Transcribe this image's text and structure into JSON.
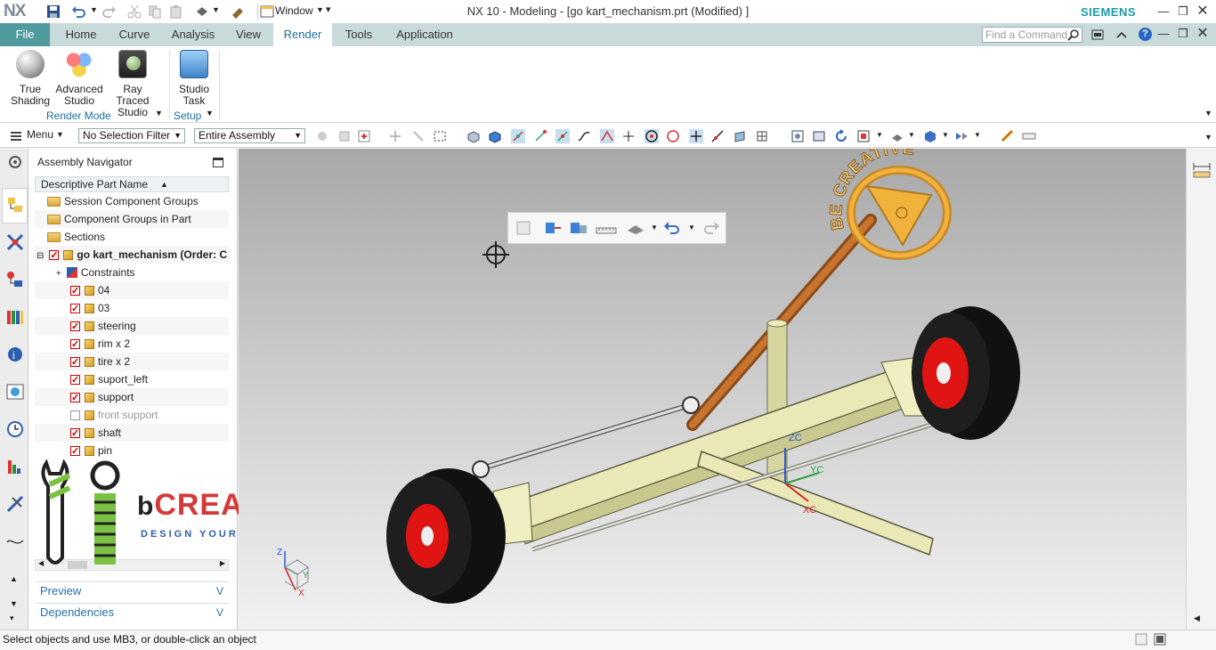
{
  "window": {
    "logo": "NX",
    "title": "NX 10 - Modeling - [go kart_mechanism.prt (Modified) ]",
    "window_menu": "Window",
    "brand": "SIEMENS"
  },
  "tabs": {
    "file": "File",
    "items": [
      "Home",
      "Curve",
      "Analysis",
      "View",
      "Render",
      "Tools",
      "Application"
    ],
    "active": "Render"
  },
  "command_finder": {
    "placeholder": "Find a Command"
  },
  "ribbon": {
    "buttons": [
      {
        "line1": "True",
        "line2": "Shading"
      },
      {
        "line1": "Advanced",
        "line2": "Studio"
      },
      {
        "line1": "Ray Traced",
        "line2": "Studio"
      },
      {
        "line1": "Studio",
        "line2": "Task"
      }
    ],
    "groups": [
      "Render Mode",
      "Setup"
    ]
  },
  "selection_bar": {
    "menu": "Menu",
    "filter": "No Selection Filter",
    "scope": "Entire Assembly"
  },
  "navigator": {
    "title": "Assembly Navigator",
    "column": "Descriptive Part Name",
    "rows": [
      {
        "label": "Session Component Groups"
      },
      {
        "label": "Component Groups in Part"
      },
      {
        "label": "Sections"
      },
      {
        "label": "go kart_mechanism (Order: C"
      },
      {
        "label": "Constraints"
      },
      {
        "label": "04"
      },
      {
        "label": "03"
      },
      {
        "label": "steering"
      },
      {
        "label": "rim x 2"
      },
      {
        "label": "tire x 2"
      },
      {
        "label": "suport_left"
      },
      {
        "label": "support"
      },
      {
        "label": "front support"
      },
      {
        "label": "shaft"
      },
      {
        "label": "pin"
      }
    ],
    "panels": [
      "Preview",
      "Dependencies"
    ]
  },
  "watermark": {
    "brand": "CREATIVE",
    "tagline": "DESIGN YOUR LIFE",
    "arc_text": "BE CREATIVE"
  },
  "axes": {
    "zc": "ZC",
    "yc": "YC",
    "xc": "XC",
    "triad_z": "Z",
    "triad_y": "Y",
    "triad_x": "X"
  },
  "status": {
    "message": "Select objects and use MB3, or double-click an object"
  },
  "colors": {
    "file_tab": "#4e9a9d",
    "tab_bar": "#c9dadb",
    "active_tab_text": "#1c6f9d",
    "brand": "#1a9aa8",
    "frame": "#e9e8b6",
    "tire": "#111111",
    "rim": "#e11414",
    "steering": "#f0b23a",
    "watermark_red": "#d43a3a"
  }
}
